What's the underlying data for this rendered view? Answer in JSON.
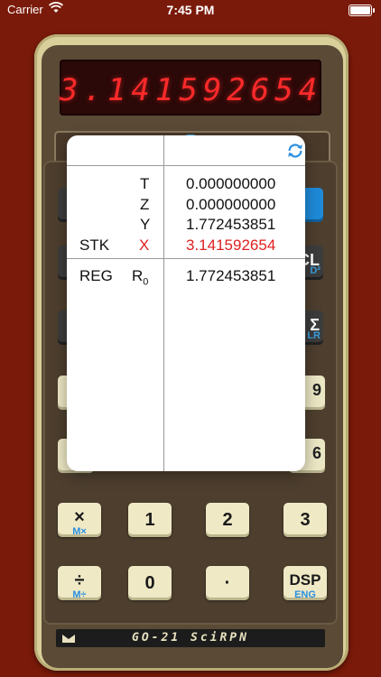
{
  "status_bar": {
    "carrier": "Carrier",
    "time": "7:45 PM"
  },
  "display": {
    "readout": "3.141592654"
  },
  "popover": {
    "stack_label": "STK",
    "stack_rows": [
      {
        "reg": "T",
        "value": "0.000000000"
      },
      {
        "reg": "Z",
        "value": "0.000000000"
      },
      {
        "reg": "Y",
        "value": "1.772453851"
      },
      {
        "reg": "X",
        "value": "3.141592654"
      }
    ],
    "reg_label": "REG",
    "reg_rows": [
      {
        "name": "R",
        "index": "0",
        "value": "1.772453851"
      }
    ],
    "x_color": "#e02020",
    "refresh_icon": "refresh-icon"
  },
  "keys": {
    "mult": {
      "main": "×",
      "alt": "M×"
    },
    "one": {
      "main": "1"
    },
    "two": {
      "main": "2"
    },
    "three": {
      "main": "3"
    },
    "div": {
      "main": "÷",
      "alt": "M÷"
    },
    "zero": {
      "main": "0"
    },
    "dot": {
      "main": "·"
    },
    "dsp": {
      "main": "DSP",
      "alt": "ENG"
    }
  },
  "partial_keys": {
    "clx": {
      "main": "CL",
      "alt": "D²"
    },
    "stat": {
      "main": "Σ",
      "alt": "LR"
    },
    "nine": {
      "main": "9"
    },
    "six": {
      "main": "6"
    }
  },
  "plate": {
    "model": "GO-21 SciRPN"
  },
  "colors": {
    "accent": "#2a8fe0",
    "background": "#7a1a0a",
    "led": "#ff2a2a"
  }
}
